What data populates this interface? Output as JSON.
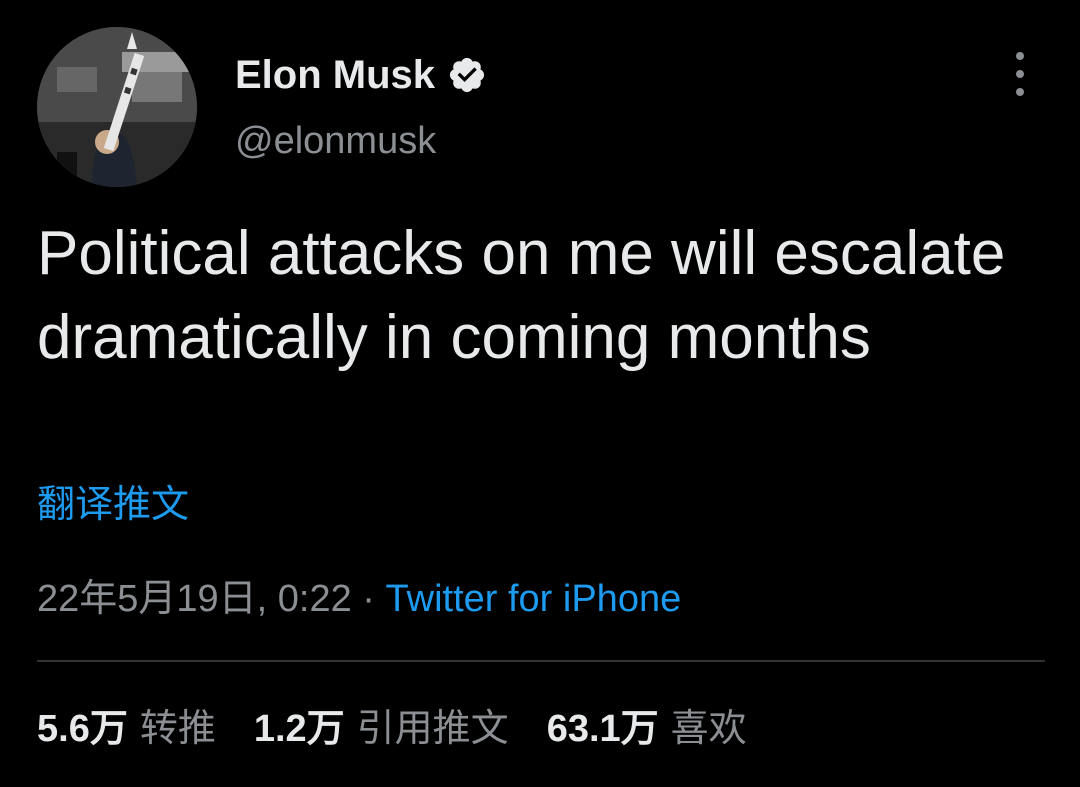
{
  "author": {
    "display_name": "Elon Musk",
    "handle": "@elonmusk",
    "verified": true
  },
  "tweet": {
    "text": "Political attacks on me will escalate dramatically in coming months",
    "translate_label": "翻译推文",
    "timestamp": "22年5月19日, 0:22",
    "separator": " · ",
    "source": "Twitter for iPhone"
  },
  "stats": [
    {
      "count": "5.6万",
      "label": "转推"
    },
    {
      "count": "1.2万",
      "label": "引用推文"
    },
    {
      "count": "63.1万",
      "label": "喜欢"
    }
  ],
  "colors": {
    "background": "#000000",
    "text": "#e7e9ea",
    "secondary": "#8b8f93",
    "link": "#1d9bf0",
    "divider": "#2f3336"
  },
  "icons": {
    "verified": "verified-badge-icon",
    "more": "more-vertical-icon"
  }
}
